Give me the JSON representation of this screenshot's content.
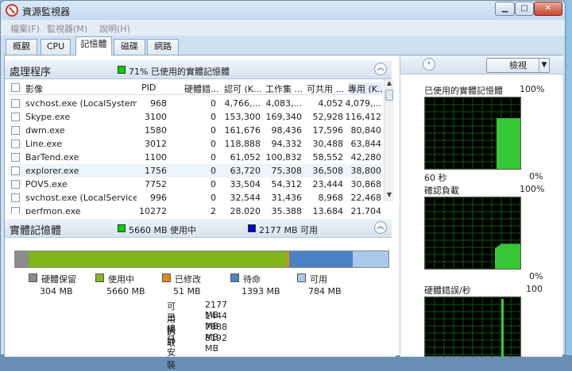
{
  "window": {
    "title": "資源監視器",
    "minimize": "▁",
    "maximize": "□",
    "close": "✕"
  },
  "menu": [
    "檔案(F)",
    "監視器(M)",
    "說明(H)"
  ],
  "tabs": [
    "概觀",
    "CPU",
    "記憶體",
    "磁碟",
    "網路"
  ],
  "active_tab": "記憶體",
  "processes": {
    "title": "處理程序",
    "summary": "71% 已使用的實體記憶體",
    "summary_color": "#00d400",
    "columns": [
      "影像",
      "PID",
      "硬體錯...",
      "認可 (K...",
      "工作集 ...",
      "可共用 ...",
      "專用 (K..."
    ],
    "rows": [
      [
        "svchost.exe (LocalSystemNe...",
        "968",
        "0",
        "4,766,...",
        "4,083,...",
        "4,052",
        "4,079,..."
      ],
      [
        "Skype.exe",
        "3100",
        "0",
        "153,300",
        "169,340",
        "52,928",
        "116,412"
      ],
      [
        "dwm.exe",
        "1580",
        "0",
        "161,676",
        "98,436",
        "17,596",
        "80,840"
      ],
      [
        "Line.exe",
        "3012",
        "0",
        "118,888",
        "94,332",
        "30,488",
        "63,844"
      ],
      [
        "BarTend.exe",
        "1100",
        "0",
        "61,052",
        "100,832",
        "58,552",
        "42,280"
      ],
      [
        "explorer.exe",
        "1756",
        "0",
        "63,720",
        "75,308",
        "36,508",
        "38,800"
      ],
      [
        "POV5.exe",
        "7752",
        "0",
        "33,504",
        "54,312",
        "23,444",
        "30,868"
      ],
      [
        "svchost.exe (LocalService)",
        "996",
        "0",
        "32,544",
        "31,436",
        "8,968",
        "22,468"
      ],
      [
        "perfmon.exe",
        "10272",
        "2",
        "28,020",
        "35,388",
        "13,684",
        "21,704"
      ]
    ]
  },
  "physical": {
    "title": "實體記憶體",
    "in_use_label": "5660 MB 使用中",
    "in_use_color": "#00d400",
    "available_label": "2177 MB 可用",
    "available_color": "#0000c8",
    "bar": [
      {
        "name": "硬體保留",
        "mb": 304,
        "color": "#8c8c8c"
      },
      {
        "name": "使用中",
        "mb": 5660,
        "color": "#82b41e"
      },
      {
        "name": "已修改",
        "mb": 51,
        "color": "#dd8a1c"
      },
      {
        "name": "待命",
        "mb": 1393,
        "color": "#4a82c6"
      },
      {
        "name": "可用",
        "mb": 784,
        "color": "#a9c8ea"
      }
    ],
    "legend": [
      {
        "name": "硬體保留",
        "value": "304 MB",
        "color": "#8c8c8c"
      },
      {
        "name": "使用中",
        "value": "5660 MB",
        "color": "#82b41e"
      },
      {
        "name": "已修改",
        "value": "51 MB",
        "color": "#dd8a1c"
      },
      {
        "name": "待命",
        "value": "1393 MB",
        "color": "#4a82c6"
      },
      {
        "name": "可用",
        "value": "784 MB",
        "color": "#a9c8ea"
      }
    ],
    "stats": [
      {
        "label": "可用的",
        "value": "2177 MB"
      },
      {
        "label": "已快取",
        "value": "1444 MB"
      },
      {
        "label": "總計",
        "value": "7888 MB"
      },
      {
        "label": "已安裝",
        "value": "8192 MB"
      }
    ]
  },
  "right_panel": {
    "view_label": "檢視",
    "graphs": [
      {
        "title": "已使用的實體記憶體",
        "max": "100%",
        "left_bottom": "60 秒",
        "right_bottom": "0%",
        "level": 71
      },
      {
        "title": "確認負載",
        "max": "100%",
        "left_bottom": "",
        "right_bottom": "0%",
        "level": 35
      },
      {
        "title": "硬體錯誤/秒",
        "max": "100",
        "left_bottom": "",
        "right_bottom": "",
        "level": 0
      }
    ]
  }
}
